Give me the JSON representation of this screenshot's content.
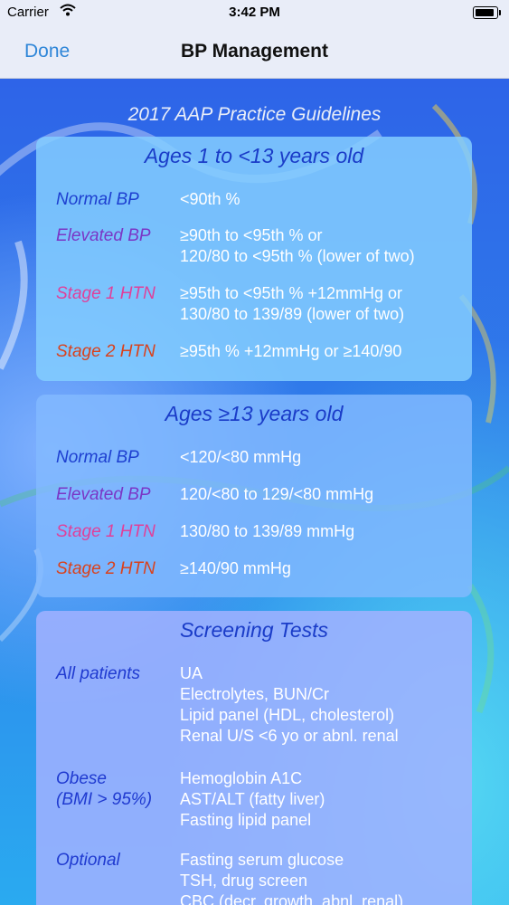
{
  "status_bar": {
    "carrier": "Carrier",
    "time": "3:42 PM",
    "battery_level": 0.9
  },
  "nav": {
    "done_label": "Done",
    "title": "BP Management"
  },
  "guidelines_title": "2017 AAP Practice Guidelines",
  "card_young": {
    "title": "Ages 1 to <13 years old",
    "rows": [
      {
        "label": "Normal BP",
        "value": "<90th %"
      },
      {
        "label": "Elevated BP",
        "value": "≥90th to <95th % or\n120/80 to <95th % (lower of two)"
      },
      {
        "label": "Stage 1 HTN",
        "value": "≥95th to <95th % +12mmHg or\n130/80 to 139/89 (lower of two)"
      },
      {
        "label": "Stage 2 HTN",
        "value": "≥95th % +12mmHg or ≥140/90"
      }
    ]
  },
  "card_teen": {
    "title": "Ages ≥13 years old",
    "rows": [
      {
        "label": "Normal BP",
        "value": "<120/<80 mmHg"
      },
      {
        "label": "Elevated BP",
        "value": "120/<80 to 129/<80 mmHg"
      },
      {
        "label": "Stage 1 HTN",
        "value": "130/80 to 139/89 mmHg"
      },
      {
        "label": "Stage 2 HTN",
        "value": "≥140/90 mmHg"
      }
    ]
  },
  "card_screening": {
    "title": "Screening Tests",
    "rows": [
      {
        "label": "All patients",
        "value": "UA\nElectrolytes, BUN/Cr\nLipid panel (HDL, cholesterol)\nRenal U/S <6 yo or abnl. renal"
      },
      {
        "label": "Obese\n(BMI > 95%)",
        "value": "Hemoglobin A1C\nAST/ALT (fatty liver)\nFasting lipid panel"
      },
      {
        "label": "Optional",
        "value": "Fasting serum glucose\nTSH, drug screen\nCBC (decr. growth, abnl. renal)"
      }
    ]
  },
  "colors": {
    "normal": "#1d3fd0",
    "elevated": "#7a36c6",
    "stage1": "#e0409a",
    "stage2": "#d9421d",
    "done": "#2f86d8"
  }
}
